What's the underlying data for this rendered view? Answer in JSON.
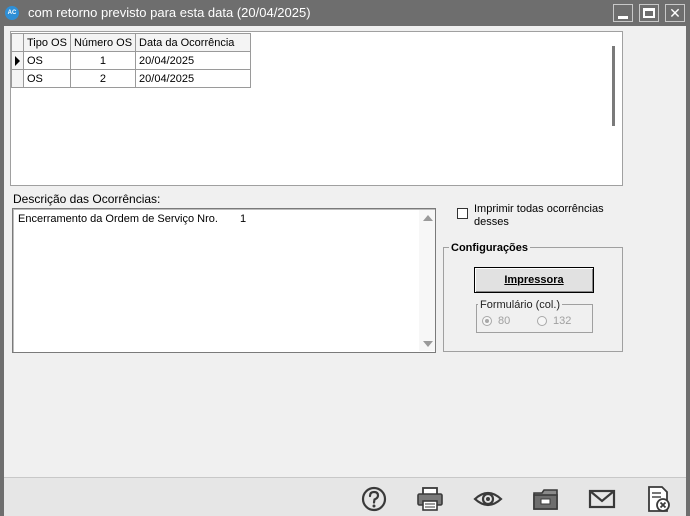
{
  "window": {
    "app_icon_text": "AC",
    "title": "com retorno previsto para esta data  (20/04/2025)"
  },
  "grid": {
    "columns": [
      "Tipo OS",
      "Número OS",
      "Data da Ocorrência"
    ],
    "rows": [
      {
        "tipo": "OS",
        "numero": "1",
        "data": "20/04/2025",
        "current": true
      },
      {
        "tipo": "OS",
        "numero": "2",
        "data": "20/04/2025",
        "current": false
      }
    ]
  },
  "descricao": {
    "label": "Descrição das Ocorrências:",
    "text": "Encerramento da Ordem de Serviço Nro.",
    "number": "1"
  },
  "options": {
    "imprimir_todas_label": "Imprimir todas ocorrências desses",
    "imprimir_todas_checked": false
  },
  "configuracoes": {
    "title": "Configurações",
    "impressora_button": "Impressora",
    "formulario_title": "Formulário (col.)",
    "radio_80": "80",
    "radio_132": "132",
    "selected": "80"
  },
  "toolbar": {
    "icons": [
      "help-icon",
      "printer-icon",
      "eye-icon",
      "folder-icon",
      "mail-icon",
      "exit-icon"
    ]
  }
}
